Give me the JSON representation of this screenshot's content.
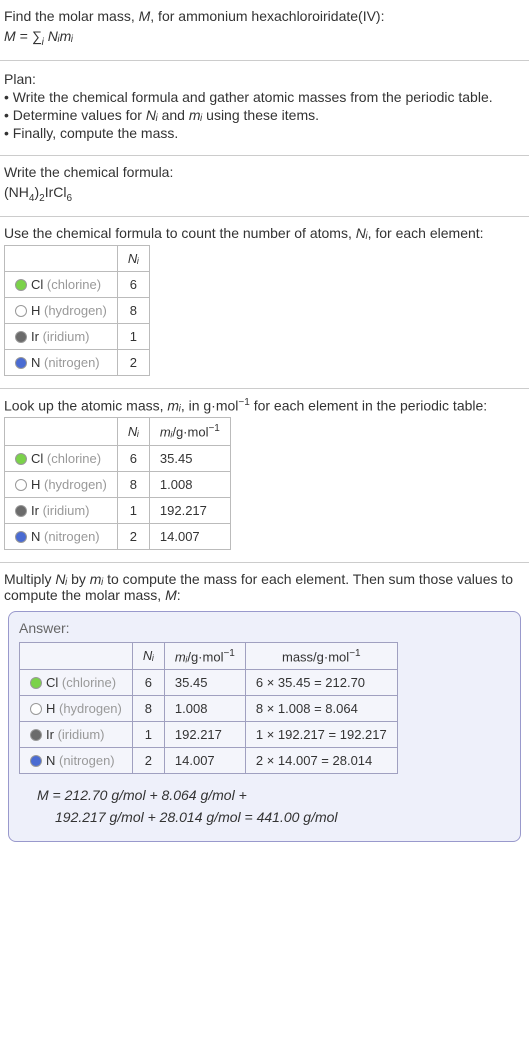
{
  "intro": {
    "line1_a": "Find the molar mass, ",
    "line1_M": "M",
    "line1_b": ", for ammonium hexachloroiridate(IV):",
    "formula_text": "M = ∑",
    "formula_sub": "i",
    "formula_tail": " Nᵢmᵢ"
  },
  "plan": {
    "title": "Plan:",
    "b1": "• Write the chemical formula and gather atomic masses from the periodic table.",
    "b2a": "• Determine values for ",
    "b2_Ni": "Nᵢ",
    "b2_mid": " and ",
    "b2_mi": "mᵢ",
    "b2b": " using these items.",
    "b3": "• Finally, compute the mass."
  },
  "chem": {
    "heading": "Write the chemical formula:",
    "a": "(NH",
    "s1": "4",
    "b": ")",
    "s2": "2",
    "c": "IrCl",
    "s3": "6"
  },
  "count": {
    "heading_a": "Use the chemical formula to count the number of atoms, ",
    "heading_Ni": "Nᵢ",
    "heading_b": ", for each element:",
    "th_Ni": "Nᵢ"
  },
  "chart_data": {
    "type": "table",
    "elements": [
      {
        "sym": "Cl",
        "name": "(chlorine)",
        "color": "#7bd24a",
        "n": "6",
        "m": "35.45",
        "mass": "6 × 35.45 = 212.70"
      },
      {
        "sym": "H",
        "name": "(hydrogen)",
        "color": "#ffffff",
        "n": "8",
        "m": "1.008",
        "mass": "8 × 1.008 = 8.064"
      },
      {
        "sym": "Ir",
        "name": "(iridium)",
        "color": "#6b6b6b",
        "n": "1",
        "m": "192.217",
        "mass": "1 × 192.217 = 192.217"
      },
      {
        "sym": "N",
        "name": "(nitrogen)",
        "color": "#4a6bd2",
        "n": "2",
        "m": "14.007",
        "mass": "2 × 14.007 = 28.014"
      }
    ]
  },
  "mass": {
    "heading_a": "Look up the atomic mass, ",
    "heading_mi": "mᵢ",
    "heading_b": ", in g·mol",
    "heading_exp": "−1",
    "heading_c": " for each element in the periodic table:",
    "th_Ni": "Nᵢ",
    "th_mi_a": "mᵢ",
    "th_mi_b": "/g·mol",
    "th_mi_exp": "−1"
  },
  "mult": {
    "heading_a": "Multiply ",
    "heading_Ni": "Nᵢ",
    "heading_mid": " by ",
    "heading_mi": "mᵢ",
    "heading_tail": " to compute the mass for each element. Then sum those values to compute the molar mass, ",
    "heading_M": "M",
    "heading_end": ":"
  },
  "answer": {
    "label": "Answer:",
    "th_Ni": "Nᵢ",
    "th_mi_a": "mᵢ",
    "th_mi_b": "/g·mol",
    "th_mi_exp": "−1",
    "th_mass_a": "mass/g·mol",
    "th_mass_exp": "−1",
    "final_a": "M = 212.70 g/mol + 8.064 g/mol +",
    "final_b": "192.217 g/mol + 28.014 g/mol = 441.00 g/mol"
  }
}
